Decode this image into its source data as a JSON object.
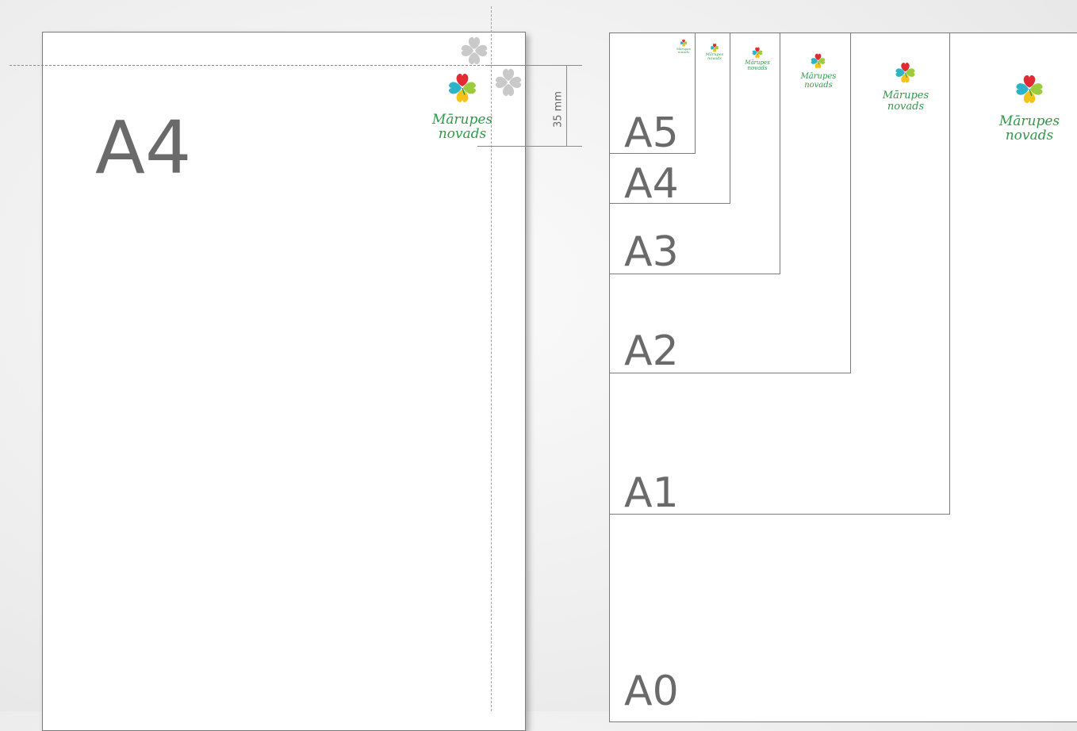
{
  "left_panel": {
    "sheet_label": "A4",
    "dimension_label": "35 mm",
    "logo": {
      "line1": "Mārupes",
      "line2": "novads",
      "icon": "clover-logo-icon"
    }
  },
  "right_panel": {
    "sizes": [
      {
        "label": "A5"
      },
      {
        "label": "A4"
      },
      {
        "label": "A3"
      },
      {
        "label": "A2"
      },
      {
        "label": "A1"
      },
      {
        "label": "A0"
      }
    ],
    "logo_line1": "Mārupes",
    "logo_line2": "novads"
  },
  "colors": {
    "red": "#e02b35",
    "cyan": "#2bb3c8",
    "lime": "#9ccb3b",
    "yellow": "#f3c318",
    "green_text": "#2e9a4a",
    "ghost": "#c9c9c9"
  }
}
